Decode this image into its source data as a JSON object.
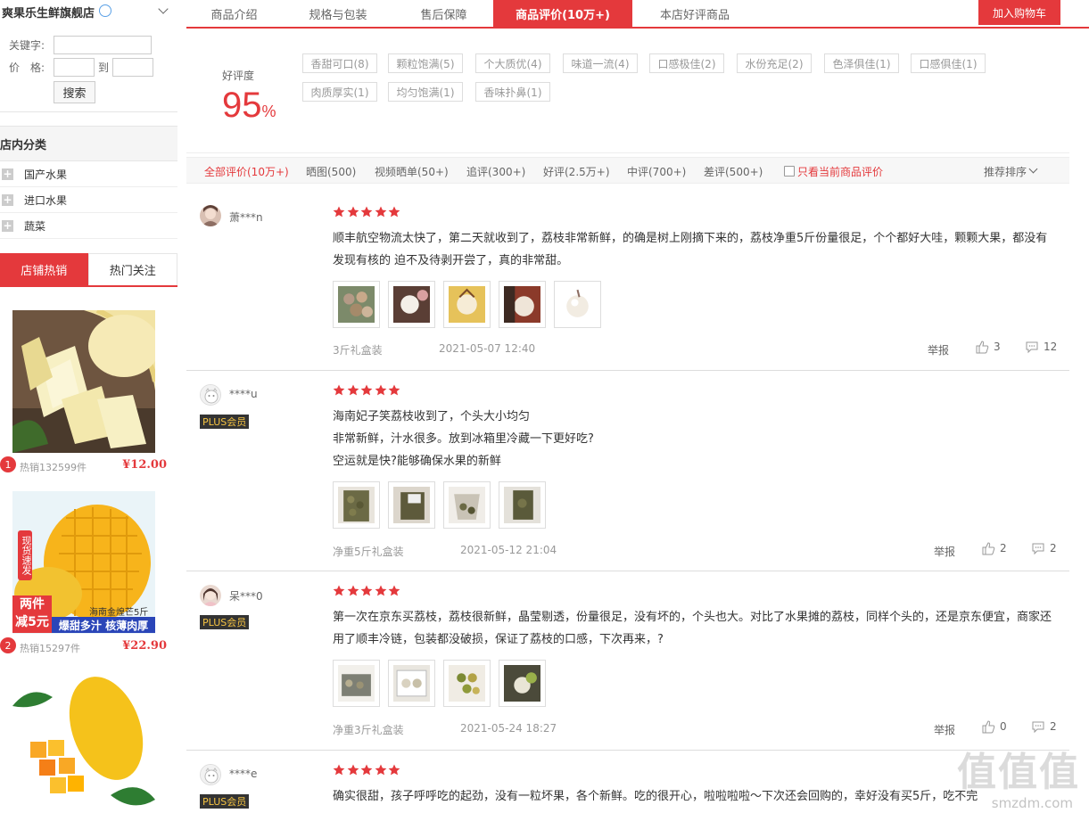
{
  "shop": {
    "name": "爽果乐生鲜旗舰店"
  },
  "search": {
    "keyword_label": "关键字:",
    "price_label": "价　格:",
    "to_label": "到",
    "button_label": "搜索",
    "keyword_value": "",
    "price_from": "",
    "price_to": ""
  },
  "categories": {
    "title": "店内分类",
    "items": [
      {
        "label": "国产水果"
      },
      {
        "label": "进口水果"
      },
      {
        "label": "蔬菜"
      }
    ]
  },
  "hot": {
    "tabs": [
      {
        "label": "店铺热销"
      },
      {
        "label": "热门关注"
      }
    ],
    "items": [
      {
        "rank": "1",
        "sales": "热销132599件",
        "price": "¥12.00"
      },
      {
        "rank": "2",
        "sales": "热销15297件",
        "price": "¥22.90",
        "promo": {
          "badge": "现货速发",
          "deal_1": "两件",
          "deal_2": "减5元",
          "variety": "海南金煌芒5斤",
          "slogan": "爆甜多汁 核薄肉厚"
        }
      },
      {
        "rank": "",
        "sales": "",
        "price": ""
      }
    ]
  },
  "tabs": [
    {
      "label": "商品介绍"
    },
    {
      "label": "规格与包装"
    },
    {
      "label": "售后保障"
    },
    {
      "label": "商品评价(10万+)"
    },
    {
      "label": "本店好评商品"
    }
  ],
  "cart_button": "加入购物车",
  "rating": {
    "label": "好评度",
    "value": "95",
    "unit": "%",
    "tags": [
      "香甜可口(8)",
      "颗粒饱满(5)",
      "个大质优(4)",
      "味道一流(4)",
      "口感极佳(2)",
      "水份充足(2)",
      "色泽俱佳(1)",
      "口感俱佳(1)",
      "肉质厚实(1)",
      "均匀饱满(1)",
      "香味扑鼻(1)"
    ]
  },
  "filters": [
    "全部评价(10万+)",
    "晒图(500)",
    "视频晒单(50+)",
    "追评(300+)",
    "好评(2.5万+)",
    "中评(700+)",
    "差评(500+)"
  ],
  "only_current": "只看当前商品评价",
  "sort_label": "推荐排序",
  "reviews": [
    {
      "user": "萧***n",
      "plus": "",
      "lines": [
        "顺丰航空物流太快了，第二天就收到了，荔枝非常新鲜，的确是树上刚摘下来的，荔枝净重5斤份量很足，个个都好大哇，颗颗大果，都没有发现有核的 迫不及待剥开尝了，真的非常甜。"
      ],
      "spec": "3斤礼盒装",
      "date": "2021-05-07 12:40",
      "report": "举报",
      "likes": "3",
      "replies": "12"
    },
    {
      "user": "****u",
      "plus": "PLUS会员",
      "lines": [
        "海南妃子笑荔枝收到了，个头大小均匀",
        "非常新鲜，汁水很多。放到冰箱里冷藏一下更好吃?",
        "空运就是快?能够确保水果的新鲜"
      ],
      "spec": "净重5斤礼盒装",
      "date": "2021-05-12 21:04",
      "report": "举报",
      "likes": "2",
      "replies": "2"
    },
    {
      "user": "呆***0",
      "plus": "PLUS会员",
      "lines": [
        "第一次在京东买荔枝，荔枝很新鲜，晶莹剔透，份量很足，没有坏的，个头也大。对比了水果摊的荔枝，同样个头的，还是京东便宜，商家还用了顺丰冷链，包装都没破损，保证了荔枝的口感，下次再来，?"
      ],
      "spec": "净重3斤礼盒装",
      "date": "2021-05-24 18:27",
      "report": "举报",
      "likes": "0",
      "replies": "2"
    },
    {
      "user": "****e",
      "plus": "PLUS会员",
      "lines": [
        "确实很甜，孩子呼呼吃的起劲，没有一粒坏果，各个新鲜。吃的很开心，啦啦啦啦～下次还会回购的，幸好没有买5斤，吃不完"
      ],
      "spec": "",
      "date": "",
      "report": "",
      "likes": "",
      "replies": ""
    }
  ],
  "watermark": {
    "main": "值值值",
    "sub": "smzdm.com"
  },
  "colors": {
    "accent": "#e4393c",
    "plus_bg": "#333333",
    "plus_fg": "#f5c342"
  }
}
